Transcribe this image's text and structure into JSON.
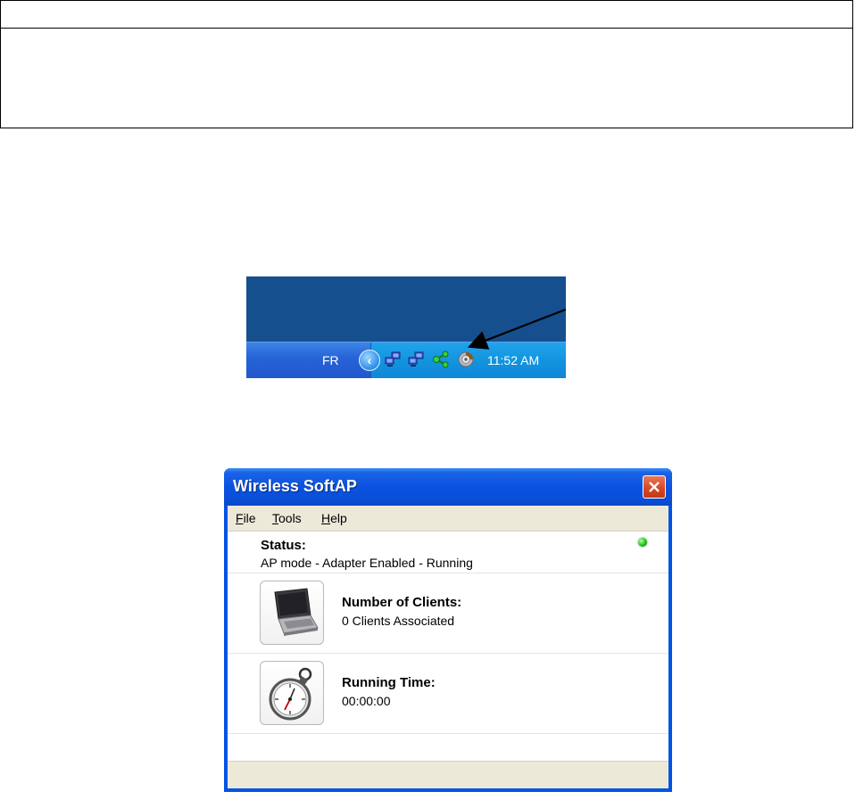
{
  "taskbar": {
    "language": "FR",
    "clock": "11:52 AM",
    "tray_icons": [
      "show-hidden-icons-icon",
      "network-connection-icon",
      "network-connection-icon",
      "green-share-icon",
      "wireless-softap-tray-icon"
    ],
    "colors": {
      "desktop": "#164f8d",
      "taskbar": "#2764d7",
      "tray": "#1395e0"
    }
  },
  "window": {
    "title": "Wireless SoftAP",
    "menu": [
      {
        "label": "File",
        "accel": "F",
        "rest": "ile"
      },
      {
        "label": "Tools",
        "accel": "T",
        "rest": "ools"
      },
      {
        "label": "Help",
        "accel": "H",
        "rest": "elp"
      }
    ],
    "status": {
      "label": "Status:",
      "value": "AP mode - Adapter Enabled - Running",
      "indicator_color": "#19c21b"
    },
    "clients": {
      "label": "Number of Clients:",
      "value": "0 Clients Associated",
      "icon": "laptop-icon"
    },
    "running_time": {
      "label": "Running Time:",
      "value": "00:00:00",
      "icon": "stopwatch-icon"
    },
    "colors": {
      "titlebar": "#0a52e0",
      "close": "#d6461f",
      "client": "#ece9d8"
    }
  }
}
